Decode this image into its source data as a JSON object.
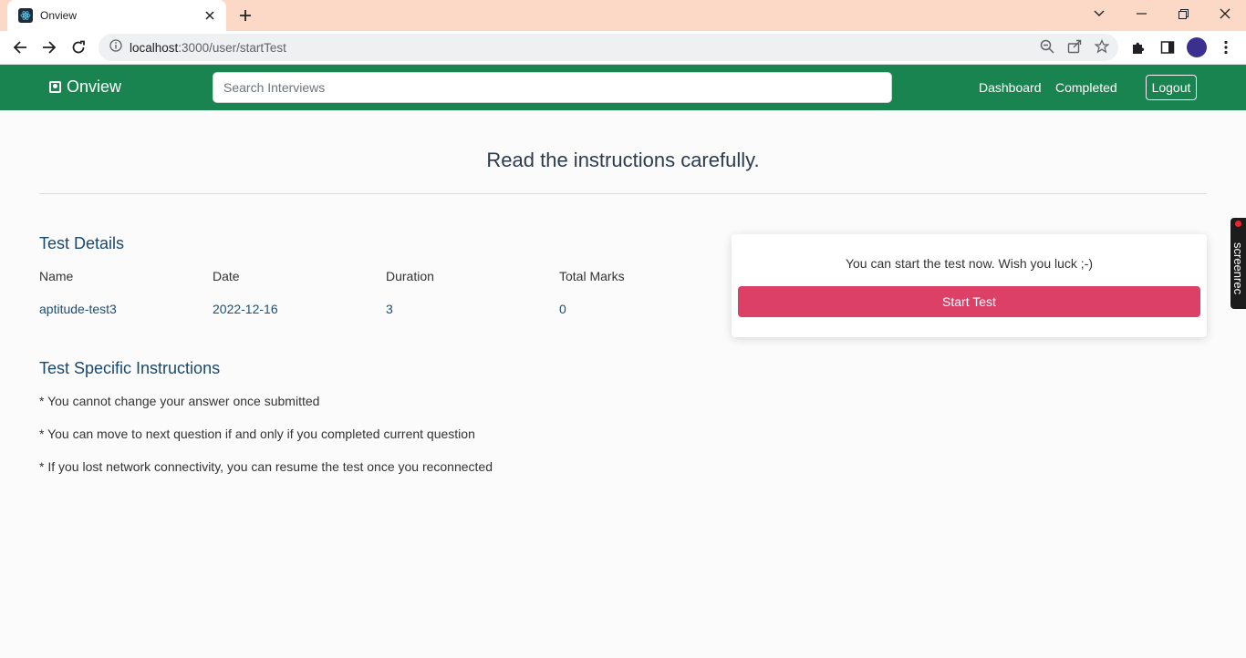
{
  "browser": {
    "tab_title": "Onview",
    "url_host": "localhost",
    "url_path": ":3000/user/startTest"
  },
  "navbar": {
    "brand": "Onview",
    "search_placeholder": "Search Interviews",
    "links": [
      "Dashboard",
      "Completed"
    ],
    "logout_label": "Logout",
    "color": "#1a8451"
  },
  "page": {
    "heading": "Read the instructions carefully."
  },
  "test_details": {
    "title": "Test Details",
    "headers": [
      "Name",
      "Date",
      "Duration",
      "Total Marks"
    ],
    "values": [
      "aptitude-test3",
      "2022-12-16",
      "3",
      "0"
    ]
  },
  "instructions": {
    "title": "Test Specific Instructions",
    "items": [
      "* You cannot change your answer once submitted",
      "* You can move to next question if and only if you completed current question",
      "* If you lost network connectivity, you can resume the test once you reconnected"
    ]
  },
  "start_card": {
    "message": "You can start the test now. Wish you luck ;-)",
    "button_label": "Start Test",
    "button_color": "#dc4066"
  },
  "overlay": {
    "label": "screenrec"
  }
}
